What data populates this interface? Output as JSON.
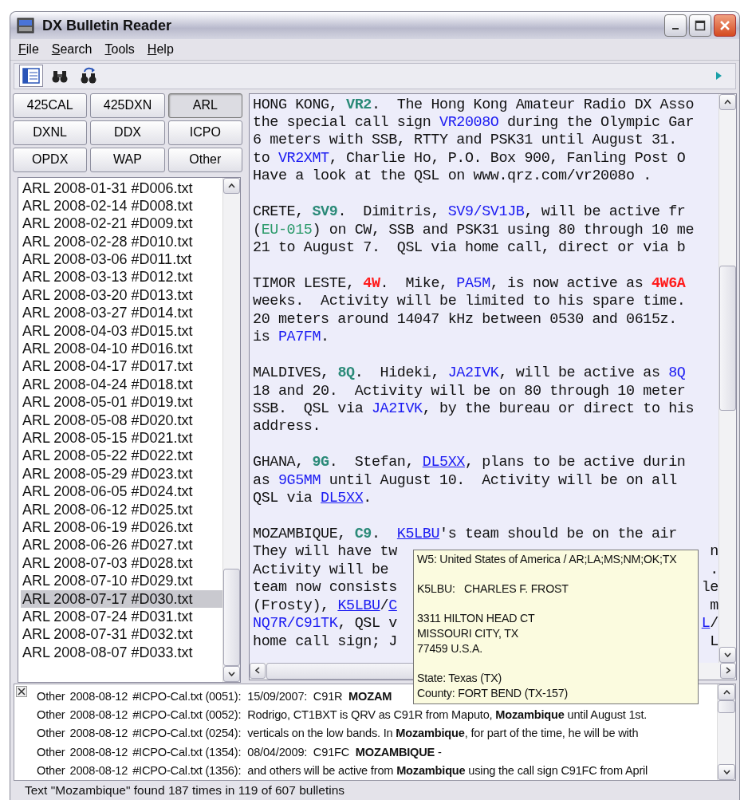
{
  "window": {
    "title": "DX Bulletin Reader"
  },
  "menu": [
    {
      "label": "File"
    },
    {
      "label": "Search"
    },
    {
      "label": "Tools"
    },
    {
      "label": "Help"
    }
  ],
  "toolbar": [
    {
      "kind": "list",
      "selected": true
    },
    {
      "kind": "find",
      "selected": false
    },
    {
      "kind": "find-next",
      "selected": false
    }
  ],
  "source_buttons": [
    {
      "label": "425CAL",
      "selected": false
    },
    {
      "label": "425DXN",
      "selected": false
    },
    {
      "label": "ARL",
      "selected": true
    },
    {
      "label": "DXNL",
      "selected": false
    },
    {
      "label": "DDX",
      "selected": false
    },
    {
      "label": "ICPO",
      "selected": false
    },
    {
      "label": "OPDX",
      "selected": false
    },
    {
      "label": "WAP",
      "selected": false
    },
    {
      "label": "Other",
      "selected": false
    }
  ],
  "file_list": [
    {
      "label": "ARL 2008-01-31 #D006.txt",
      "selected": false
    },
    {
      "label": "ARL 2008-02-14 #D008.txt",
      "selected": false
    },
    {
      "label": "ARL 2008-02-21 #D009.txt",
      "selected": false
    },
    {
      "label": "ARL 2008-02-28 #D010.txt",
      "selected": false
    },
    {
      "label": "ARL 2008-03-06 #D011.txt",
      "selected": false
    },
    {
      "label": "ARL 2008-03-13 #D012.txt",
      "selected": false
    },
    {
      "label": "ARL 2008-03-20 #D013.txt",
      "selected": false
    },
    {
      "label": "ARL 2008-03-27 #D014.txt",
      "selected": false
    },
    {
      "label": "ARL 2008-04-03 #D015.txt",
      "selected": false
    },
    {
      "label": "ARL 2008-04-10 #D016.txt",
      "selected": false
    },
    {
      "label": "ARL 2008-04-17 #D017.txt",
      "selected": false
    },
    {
      "label": "ARL 2008-04-24 #D018.txt",
      "selected": false
    },
    {
      "label": "ARL 2008-05-01 #D019.txt",
      "selected": false
    },
    {
      "label": "ARL 2008-05-08 #D020.txt",
      "selected": false
    },
    {
      "label": "ARL 2008-05-15 #D021.txt",
      "selected": false
    },
    {
      "label": "ARL 2008-05-22 #D022.txt",
      "selected": false
    },
    {
      "label": "ARL 2008-05-29 #D023.txt",
      "selected": false
    },
    {
      "label": "ARL 2008-06-05 #D024.txt",
      "selected": false
    },
    {
      "label": "ARL 2008-06-12 #D025.txt",
      "selected": false
    },
    {
      "label": "ARL 2008-06-19 #D026.txt",
      "selected": false
    },
    {
      "label": "ARL 2008-06-26 #D027.txt",
      "selected": false
    },
    {
      "label": "ARL 2008-07-03 #D028.txt",
      "selected": false
    },
    {
      "label": "ARL 2008-07-10 #D029.txt",
      "selected": false
    },
    {
      "label": "ARL 2008-07-17 #D030.txt",
      "selected": true
    },
    {
      "label": "ARL 2008-07-24 #D031.txt",
      "selected": false
    },
    {
      "label": "ARL 2008-07-31 #D032.txt",
      "selected": false
    },
    {
      "label": "ARL 2008-08-07 #D033.txt",
      "selected": false
    }
  ],
  "bulletin": [
    {
      "kind": "line",
      "segments": [
        {
          "kind": "plain",
          "text": "HONG KONG, "
        },
        {
          "kind": "prefix",
          "text": "VR2"
        },
        {
          "kind": "plain",
          "text": ".  The Hong Kong Amateur Radio DX Asso"
        }
      ]
    },
    {
      "kind": "line",
      "segments": [
        {
          "kind": "plain",
          "text": "the special call sign "
        },
        {
          "kind": "call",
          "text": "VR2008O"
        },
        {
          "kind": "plain",
          "text": " during the Olympic Gar"
        }
      ]
    },
    {
      "kind": "line",
      "segments": [
        {
          "kind": "plain",
          "text": "6 meters with SSB, RTTY and PSK31 until August 31."
        }
      ]
    },
    {
      "kind": "line",
      "segments": [
        {
          "kind": "plain",
          "text": "to "
        },
        {
          "kind": "call",
          "text": "VR2XMT"
        },
        {
          "kind": "plain",
          "text": ", Charlie Ho, P.O. Box 900, Fanling Post O"
        }
      ]
    },
    {
      "kind": "line",
      "segments": [
        {
          "kind": "plain",
          "text": "Have a look at the QSL on www.qrz.com/vr2008o ."
        }
      ]
    },
    {
      "kind": "blank"
    },
    {
      "kind": "line",
      "segments": [
        {
          "kind": "plain",
          "text": "CRETE, "
        },
        {
          "kind": "prefix",
          "text": "SV9"
        },
        {
          "kind": "plain",
          "text": ".  Dimitris, "
        },
        {
          "kind": "call",
          "text": "SV9/SV1JB"
        },
        {
          "kind": "plain",
          "text": ", will be active fr"
        }
      ]
    },
    {
      "kind": "line",
      "segments": [
        {
          "kind": "plain",
          "text": "("
        },
        {
          "kind": "island",
          "text": "EU-015"
        },
        {
          "kind": "plain",
          "text": ") on CW, SSB and PSK31 using 80 through 10 me"
        }
      ]
    },
    {
      "kind": "line",
      "segments": [
        {
          "kind": "plain",
          "text": "21 to August 7.  QSL via home call, direct or via b"
        }
      ]
    },
    {
      "kind": "blank"
    },
    {
      "kind": "line",
      "segments": [
        {
          "kind": "plain",
          "text": "TIMOR LESTE, "
        },
        {
          "kind": "red",
          "text": "4W"
        },
        {
          "kind": "plain",
          "text": ".  Mike, "
        },
        {
          "kind": "call",
          "text": "PA5M"
        },
        {
          "kind": "plain",
          "text": ", is now active as "
        },
        {
          "kind": "red",
          "text": "4W6A"
        }
      ]
    },
    {
      "kind": "line",
      "segments": [
        {
          "kind": "plain",
          "text": "weeks.  Activity will be limited to his spare time."
        }
      ]
    },
    {
      "kind": "line",
      "segments": [
        {
          "kind": "plain",
          "text": "20 meters around 14047 kHz between 0530 and 0615z."
        }
      ]
    },
    {
      "kind": "line",
      "segments": [
        {
          "kind": "plain",
          "text": "is "
        },
        {
          "kind": "call",
          "text": "PA7FM"
        },
        {
          "kind": "plain",
          "text": "."
        }
      ]
    },
    {
      "kind": "blank"
    },
    {
      "kind": "line",
      "segments": [
        {
          "kind": "plain",
          "text": "MALDIVES, "
        },
        {
          "kind": "prefix",
          "text": "8Q"
        },
        {
          "kind": "plain",
          "text": ".  Hideki, "
        },
        {
          "kind": "call",
          "text": "JA2IVK"
        },
        {
          "kind": "plain",
          "text": ", will be active as "
        },
        {
          "kind": "call",
          "text": "8Q"
        }
      ]
    },
    {
      "kind": "line",
      "segments": [
        {
          "kind": "plain",
          "text": "18 and 20.  Activity will be on 80 through 10 meter"
        }
      ]
    },
    {
      "kind": "line",
      "segments": [
        {
          "kind": "plain",
          "text": "SSB.  QSL via "
        },
        {
          "kind": "call",
          "text": "JA2IVK"
        },
        {
          "kind": "plain",
          "text": ", by the bureau or direct to his"
        }
      ]
    },
    {
      "kind": "line",
      "segments": [
        {
          "kind": "plain",
          "text": "address."
        }
      ]
    },
    {
      "kind": "blank"
    },
    {
      "kind": "line",
      "segments": [
        {
          "kind": "plain",
          "text": "GHANA, "
        },
        {
          "kind": "prefix",
          "text": "9G"
        },
        {
          "kind": "plain",
          "text": ".  Stefan, "
        },
        {
          "kind": "link",
          "text": "DL5XX"
        },
        {
          "kind": "plain",
          "text": ", plans to be active durin"
        }
      ]
    },
    {
      "kind": "line",
      "segments": [
        {
          "kind": "plain",
          "text": "as "
        },
        {
          "kind": "call",
          "text": "9G5MM"
        },
        {
          "kind": "plain",
          "text": " until August 10.  Activity will be on all"
        }
      ]
    },
    {
      "kind": "line",
      "segments": [
        {
          "kind": "plain",
          "text": "QSL via "
        },
        {
          "kind": "link",
          "text": "DL5XX"
        },
        {
          "kind": "plain",
          "text": "."
        }
      ]
    },
    {
      "kind": "blank"
    },
    {
      "kind": "line",
      "segments": [
        {
          "kind": "plain",
          "text": "MOZAMBIQUE, "
        },
        {
          "kind": "prefix",
          "text": "C9"
        },
        {
          "kind": "plain",
          "text": ".  "
        },
        {
          "kind": "link",
          "text": "K5LBU"
        },
        {
          "kind": "plain",
          "text": "'s team should be on the air"
        }
      ]
    },
    {
      "kind": "split",
      "segments": [
        {
          "kind": "plain",
          "text": "They will have tw"
        }
      ],
      "right": [
        {
          "kind": "plain",
          "text": "n"
        }
      ]
    },
    {
      "kind": "split",
      "segments": [
        {
          "kind": "plain",
          "text": "Activity will be"
        }
      ],
      "right": [
        {
          "kind": "plain",
          "text": "."
        }
      ]
    },
    {
      "kind": "split",
      "segments": [
        {
          "kind": "plain",
          "text": "team now consists"
        }
      ],
      "right": [
        {
          "kind": "plain",
          "text": "le"
        }
      ]
    },
    {
      "kind": "split",
      "segments": [
        {
          "kind": "plain",
          "text": "(Frosty), "
        },
        {
          "kind": "link",
          "text": "K5LBU"
        },
        {
          "kind": "plain",
          "text": "/"
        },
        {
          "kind": "link",
          "text": "C"
        }
      ],
      "right": [
        {
          "kind": "plain",
          "text": "m"
        }
      ]
    },
    {
      "kind": "split",
      "segments": [
        {
          "kind": "call",
          "text": "NQ7R/C91TK"
        },
        {
          "kind": "plain",
          "text": ", QSL v"
        }
      ],
      "right": [
        {
          "kind": "link",
          "text": "L"
        },
        {
          "kind": "plain",
          "text": "/"
        }
      ]
    },
    {
      "kind": "split",
      "segments": [
        {
          "kind": "plain",
          "text": "home call sign; J"
        }
      ],
      "right": [
        {
          "kind": "plain",
          "text": "L"
        }
      ]
    }
  ],
  "tooltip": [
    [
      "W5: United States of America / AR;LA;MS;NM;OK;TX"
    ],
    [
      "K5LBU:   CHARLES F. FROST"
    ],
    [
      "3311 HILTON HEAD CT",
      "MISSOURI CITY, TX",
      "77459 U.S.A."
    ],
    [
      "State: Texas (TX)",
      "County: FORT BEND (TX-157)"
    ]
  ],
  "results": [
    {
      "source": "Other",
      "date": "2008-08-12",
      "file": "#ICPO-Cal.txt (0051):",
      "snippet": "15/09/2007:  C91R  **MOZAM**"
    },
    {
      "source": "Other",
      "date": "2008-08-12",
      "file": "#ICPO-Cal.txt (0052):",
      "snippet": "Rodrigo, CT1BXT is QRV as C91R from Maputo, **Mozambique** until August 1st."
    },
    {
      "source": "Other",
      "date": "2008-08-12",
      "file": "#ICPO-Cal.txt (0254):",
      "snippet": "verticals on the low bands. In **Mozambique**, for part of the time, he will be with"
    },
    {
      "source": "Other",
      "date": "2008-08-12",
      "file": "#ICPO-Cal.txt (1354):",
      "snippet": "08/04/2009:  C91FC  **MOZAMBIQUE** -"
    },
    {
      "source": "Other",
      "date": "2008-08-12",
      "file": "#ICPO-Cal.txt (1356):",
      "snippet": "and others will be active from **Mozambique** using the call sign C91FC from April"
    }
  ],
  "status_bar": {
    "text": "Text \"Mozambique\" found 187 times in 119 of 607 bulletins"
  }
}
